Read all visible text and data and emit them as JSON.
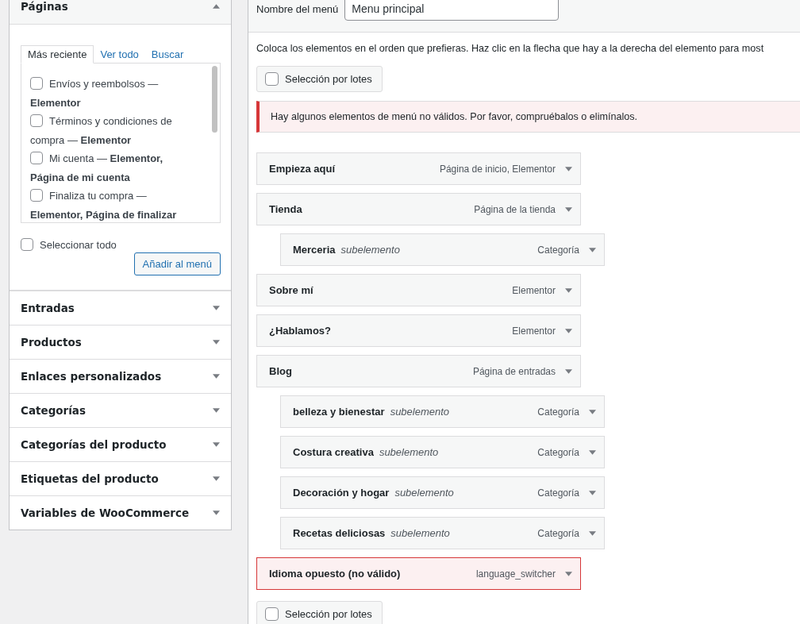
{
  "sidebar": {
    "sections": [
      {
        "title": "Páginas",
        "expanded": true,
        "tabs": [
          {
            "label": "Más reciente",
            "selected": true
          },
          {
            "label": "Ver todo",
            "selected": false
          },
          {
            "label": "Buscar",
            "selected": false
          }
        ],
        "items": [
          {
            "label": "Envíos y reembolsos — **Elementor**",
            "checked": false
          },
          {
            "label": "Términos y condiciones de compra — **Elementor**",
            "checked": false
          },
          {
            "label": "Mi cuenta — **Elementor, Página de mi cuenta**",
            "checked": false
          },
          {
            "label": "Finaliza tu compra — **Elementor, Página de finalizar**",
            "checked": false
          }
        ],
        "select_all": {
          "label": "Seleccionar todo",
          "checked": false
        },
        "add_button": "Añadir al menú"
      },
      {
        "title": "Entradas",
        "expanded": false
      },
      {
        "title": "Productos",
        "expanded": false
      },
      {
        "title": "Enlaces personalizados",
        "expanded": false
      },
      {
        "title": "Categorías",
        "expanded": false
      },
      {
        "title": "Categorías del producto",
        "expanded": false
      },
      {
        "title": "Etiquetas del producto",
        "expanded": false
      },
      {
        "title": "Variables de WooCommerce",
        "expanded": false
      }
    ]
  },
  "menu": {
    "name_label": "Nombre del menú",
    "name_value": "Menu principal",
    "description": "Coloca los elementos en el orden que prefieras. Haz clic en la flecha que hay a la derecha del elemento para most",
    "bulk_select": {
      "label": "Selección por lotes",
      "checked": false
    },
    "notice": "Hay algunos elementos de menú no válidos. Por favor, compruébalos o elimínalos.",
    "items": [
      {
        "title": "Empieza aquí",
        "type": "Página de inicio, Elementor",
        "invalid": false
      },
      {
        "title": "Tienda",
        "type": "Página de la tienda",
        "invalid": false,
        "children": [
          {
            "title": "Merceria",
            "note": "subelemento",
            "type": "Categoría",
            "invalid": false
          }
        ]
      },
      {
        "title": "Sobre mí",
        "type": "Elementor",
        "invalid": false
      },
      {
        "title": "¿Hablamos?",
        "type": "Elementor",
        "invalid": false
      },
      {
        "title": "Blog",
        "type": "Página de entradas",
        "invalid": false,
        "children": [
          {
            "title": "belleza y bienestar",
            "note": "subelemento",
            "type": "Categoría",
            "invalid": false
          },
          {
            "title": "Costura creativa",
            "note": "subelemento",
            "type": "Categoría",
            "invalid": false
          },
          {
            "title": "Decoración y hogar",
            "note": "subelemento",
            "type": "Categoría",
            "invalid": false
          },
          {
            "title": "Recetas deliciosas",
            "note": "subelemento",
            "type": "Categoría",
            "invalid": false
          }
        ]
      },
      {
        "title": "Idioma opuesto (no válido)",
        "type": "language_switcher",
        "invalid": true
      }
    ],
    "bulk_select_bottom": {
      "label": "Selección por lotes",
      "checked": false
    }
  }
}
